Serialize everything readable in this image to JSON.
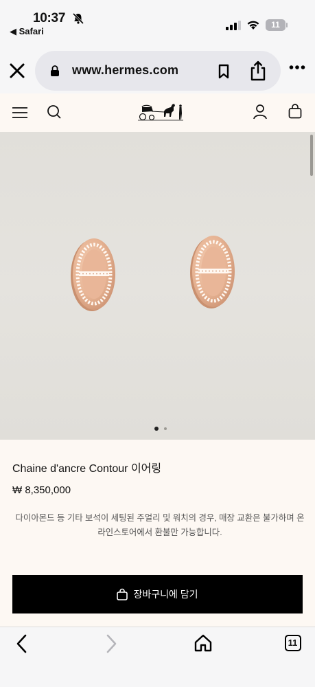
{
  "status_bar": {
    "time": "10:37",
    "back_label": "◀ Safari",
    "battery": "11"
  },
  "safari": {
    "url": "www.hermes.com",
    "tab_count": "11"
  },
  "product": {
    "title": "Chaine d'ancre Contour 이어링",
    "price": "₩ 8,350,000",
    "notice": "다이아몬드 등 기타 보석이 세팅된 주얼리 및 워치의 경우, 매장 교환은 불가하며 온라인스토어에서 환불만 가능합니다.",
    "add_to_cart": "장바구니에  담기"
  },
  "gallery": {
    "current_page": 1,
    "page_count": 2
  },
  "colors": {
    "accent": "#000000",
    "page_bg": "#fdf8f3",
    "gold": "#e6b393"
  }
}
